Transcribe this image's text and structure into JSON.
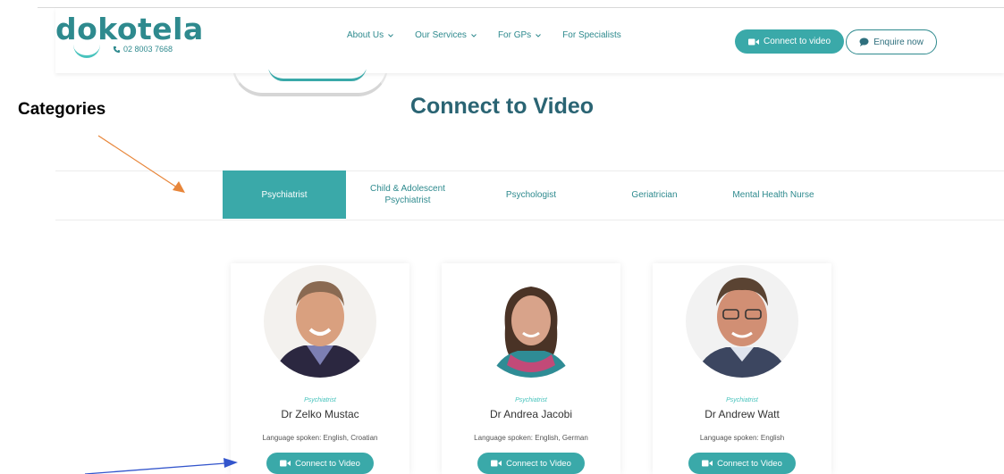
{
  "header": {
    "logo_text": "dokotela",
    "phone": "02 8003 7668",
    "nav": [
      {
        "label": "About Us",
        "has_dropdown": true
      },
      {
        "label": "Our Services",
        "has_dropdown": true
      },
      {
        "label": "For GPs",
        "has_dropdown": true
      },
      {
        "label": "For Specialists",
        "has_dropdown": false
      }
    ],
    "connect_label": "Connect to video",
    "enquire_label": "Enquire now"
  },
  "annotations": {
    "categories_label": "Categories"
  },
  "page_title": "Connect to Video",
  "tabs": [
    {
      "label": "Psychiatrist",
      "active": true
    },
    {
      "label": "Child & Adolescent Psychiatrist",
      "active": false
    },
    {
      "label": "Psychologist",
      "active": false
    },
    {
      "label": "Geriatrician",
      "active": false
    },
    {
      "label": "Mental Health Nurse",
      "active": false
    }
  ],
  "doctors": [
    {
      "role": "Psychiatrist",
      "name": "Dr Zelko Mustac",
      "language": "Language spoken: English, Croatian",
      "button": "Connect to Video"
    },
    {
      "role": "Psychiatrist",
      "name": "Dr Andrea Jacobi",
      "language": "Language spoken: English, German",
      "button": "Connect to Video"
    },
    {
      "role": "Psychiatrist",
      "name": "Dr Andrew Watt",
      "language": "Language spoken: English",
      "button": "Connect to Video"
    }
  ],
  "colors": {
    "brand_teal": "#3aa9a9",
    "dark_teal": "#2a6473",
    "annotation_orange": "#e8863a",
    "annotation_blue": "#3355cc"
  }
}
